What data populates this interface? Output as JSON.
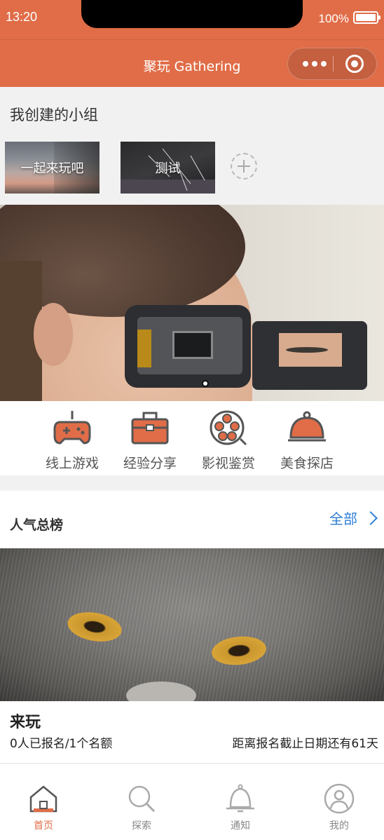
{
  "status": {
    "time": "13:20",
    "battery": "100%"
  },
  "nav": {
    "title": "聚玩 Gathering",
    "more_icon": "more-dots-icon",
    "close_icon": "target-icon"
  },
  "groups": {
    "title": "我创建的小组",
    "items": [
      {
        "label": "一起来玩吧"
      },
      {
        "label": "测试"
      }
    ],
    "add_icon": "plus-circle-icon"
  },
  "categories": [
    {
      "label": "线上游戏",
      "icon": "gamepad-icon"
    },
    {
      "label": "经验分享",
      "icon": "briefcase-icon"
    },
    {
      "label": "影视鉴赏",
      "icon": "film-reel-icon"
    },
    {
      "label": "美食探店",
      "icon": "food-cloche-icon"
    }
  ],
  "popular": {
    "title": "人气总榜",
    "all_label": "全部",
    "item": {
      "name": "来玩",
      "count": "0人已报名/1个名额",
      "deadline": "距离报名截止日期还有61天"
    }
  },
  "tabs": [
    {
      "label": "首页",
      "icon": "home-icon",
      "active": true
    },
    {
      "label": "探索",
      "icon": "search-icon",
      "active": false
    },
    {
      "label": "通知",
      "icon": "bell-icon",
      "active": false
    },
    {
      "label": "我的",
      "icon": "user-icon",
      "active": false
    }
  ],
  "colors": {
    "brand": "#e06d48",
    "link": "#2e7fd4",
    "icon_dark": "#555555"
  }
}
